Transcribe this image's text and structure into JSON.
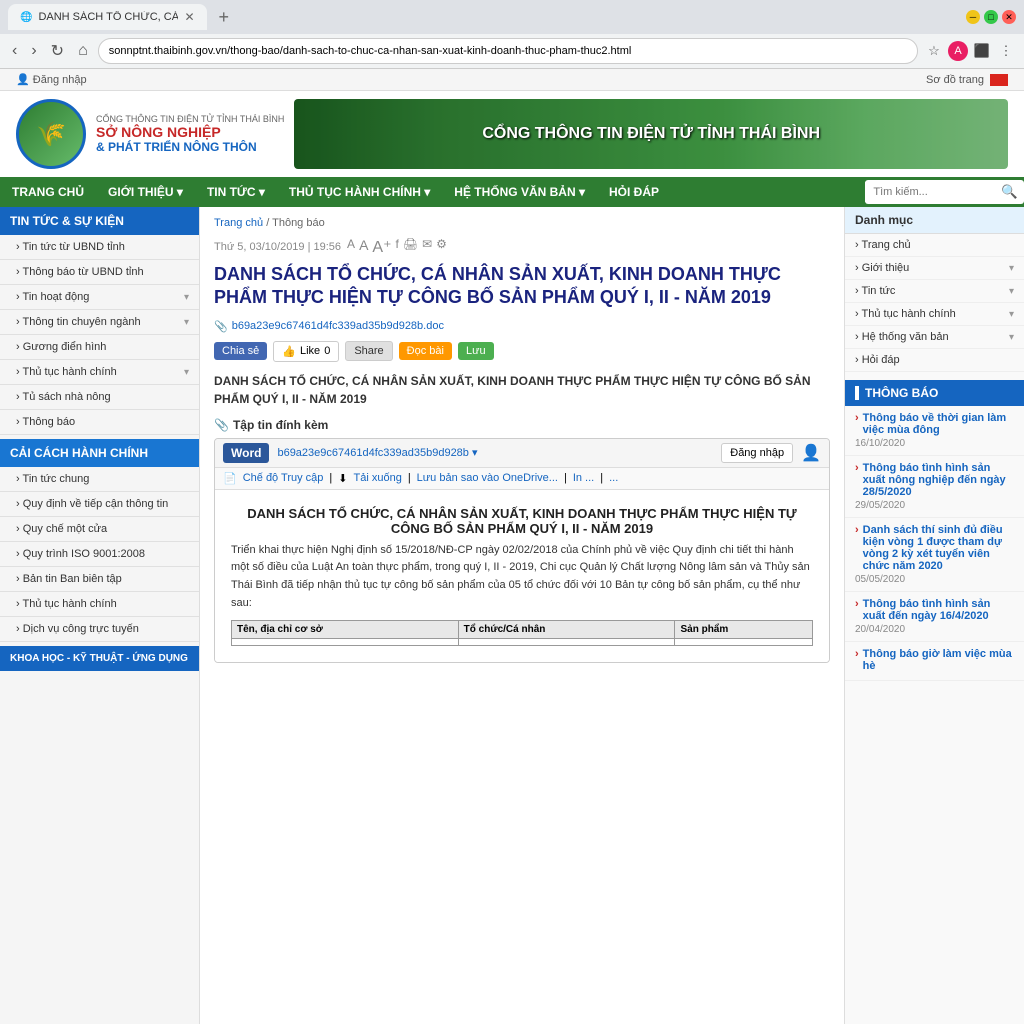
{
  "browser": {
    "tab_title": "DANH SÁCH TỔ CHỨC, CÁ NH...",
    "url": "sonnptnt.thaibinh.gov.vn/thong-bao/danh-sach-to-chuc-ca-nhan-san-xuat-kinh-doanh-thuc-pham-thuc2.html",
    "nav": {
      "back": "‹",
      "forward": "›",
      "refresh": "↻",
      "home": "⌂"
    }
  },
  "site": {
    "topbar": {
      "login": "Đăng nhập",
      "sitemap": "Sơ đồ trang"
    },
    "logo": {
      "title": "CỔNG THÔNG TIN ĐIỆN TỬ TỈNH THÁI BÌNH",
      "main": "SỞ NÔNG NGHIỆP & PHÁT TRIỂN NÔNG THÔN"
    },
    "nav_items": [
      "TRANG CHỦ",
      "GIỚI THIỆU",
      "TIN TỨC",
      "THỦ TỤC HÀNH CHÍNH",
      "HỆ THỐNG VĂN BẢN",
      "HỎI ĐÁP"
    ],
    "search_placeholder": "Tìm kiếm..."
  },
  "left_sidebar": {
    "sections": [
      {
        "header": "TIN TỨC & SỰ KIỆN",
        "color": "blue",
        "items": [
          {
            "label": "Tin tức từ UBND tỉnh",
            "has_arrow": false
          },
          {
            "label": "Thông báo từ UBND tỉnh",
            "has_arrow": false
          },
          {
            "label": "Tin hoạt động",
            "has_arrow": true
          },
          {
            "label": "Thông tin chuyên ngành",
            "has_arrow": true
          },
          {
            "label": "Gương điển hình",
            "has_arrow": false
          },
          {
            "label": "Thủ tục hành chính",
            "has_arrow": true
          },
          {
            "label": "Tủ sách nhà nông",
            "has_arrow": false
          },
          {
            "label": "Thông báo",
            "has_arrow": false
          }
        ]
      },
      {
        "header": "CẢI CÁCH HÀNH CHÍNH",
        "color": "blue",
        "items": [
          {
            "label": "Tin tức chung",
            "has_arrow": false
          },
          {
            "label": "Quy định về tiếp cận thông tin",
            "has_arrow": false
          },
          {
            "label": "Quy chế một cửa",
            "has_arrow": false
          },
          {
            "label": "Quy trình ISO 9001:2008",
            "has_arrow": false
          },
          {
            "label": "Bản tin Ban biên tập",
            "has_arrow": false
          },
          {
            "label": "Thủ tục hành chính",
            "has_arrow": false
          },
          {
            "label": "Dịch vụ công trực tuyến",
            "has_arrow": false
          }
        ]
      },
      {
        "header": "KHOA HỌC - KỸ THUẬT - ỨNG DỤNG",
        "color": "blue",
        "items": []
      }
    ]
  },
  "breadcrumb": {
    "items": [
      "Trang chủ",
      "Thông báo"
    ]
  },
  "article": {
    "date": "Thứ 5, 03/10/2019 | 19:56",
    "title": "DANH SÁCH TỔ CHỨC, CÁ NHÂN SẢN XUẤT, KINH DOANH THỰC PHẨM THỰC HIỆN TỰ CÔNG BỐ SẢN PHẨM QUÝ I, II - NĂM 2019",
    "file_link": "b69a23e9c67461d4fc339ad35b9d928b.doc",
    "social": {
      "share": "Chia sẻ",
      "like": "Like 0",
      "share2": "Share",
      "docbai": "Đọc bài",
      "luu": "Lưu"
    },
    "intro": "DANH SÁCH TỔ CHỨC, CÁ NHÂN SẢN XUẤT, KINH DOANH THỰC PHẨM THỰC HIỆN TỰ CÔNG BỐ SẢN PHẨM QUÝ I, II - NĂM 2019",
    "attachment_label": "Tập tin đính kèm",
    "word_embed": {
      "label": "Word",
      "filename": "b69a23e9c67461d4fc339ad35b9d928b ▾",
      "login_text": "Đăng nhập",
      "actions": [
        "Chế độ Truy cập",
        "Tải xuống",
        "Lưu bản sao vào OneDrive...",
        "In ...",
        "..."
      ],
      "doc_title": "DANH SÁCH TỔ CHỨC, CÁ NHÂN SẢN XUẤT, KINH DOANH THỰC PHẨM THỰC HIỆN TỰ CÔNG BỐ SẢN PHẨM QUÝ I, II - NĂM 2019",
      "doc_content": "Triển khai thực hiện Nghị định số 15/2018/NĐ-CP ngày 02/02/2018 của Chính phủ về việc Quy định chi tiết thi hành một số điều của Luật An toàn thực phẩm, trong quý I, II - 2019, Chi cục Quản lý Chất lượng Nông lâm sản và Thủy sản Thái Bình đã tiếp nhận thủ tục tự công bố sản phẩm của 05 tổ chức đối với 10 Bản tự công bố sản phẩm, cụ thể như sau:",
      "table_header": [
        "Tên, địa chỉ cơ sở",
        "Tổ chức...",
        "..."
      ]
    }
  },
  "right_sidebar": {
    "danh_muc": {
      "header": "Danh mục",
      "items": [
        {
          "label": "Trang chủ",
          "has_arrow": false
        },
        {
          "label": "Giới thiệu",
          "has_arrow": true
        },
        {
          "label": "Tin tức",
          "has_arrow": true
        },
        {
          "label": "Thủ tục hành chính",
          "has_arrow": true
        },
        {
          "label": "Hệ thống văn bản",
          "has_arrow": true
        },
        {
          "label": "Hỏi đáp",
          "has_arrow": false
        }
      ]
    },
    "thongbao": {
      "header": "THÔNG BÁO",
      "news": [
        {
          "text": "Thông báo về thời gian làm việc mùa đông",
          "date": "16/10/2020"
        },
        {
          "text": "Thông báo tình hình sản xuất nông nghiệp đến ngày 28/5/2020",
          "date": "29/05/2020"
        },
        {
          "text": "Danh sách thí sinh đủ điều kiện vòng 1 được tham dự vòng 2 kỳ xét tuyển viên chức năm 2020",
          "date": "05/05/2020"
        },
        {
          "text": "Thông báo tình hình sản xuất đến ngày 16/4/2020",
          "date": "20/04/2020"
        },
        {
          "text": "Thông báo giờ làm việc mùa hè",
          "date": ""
        }
      ]
    }
  }
}
